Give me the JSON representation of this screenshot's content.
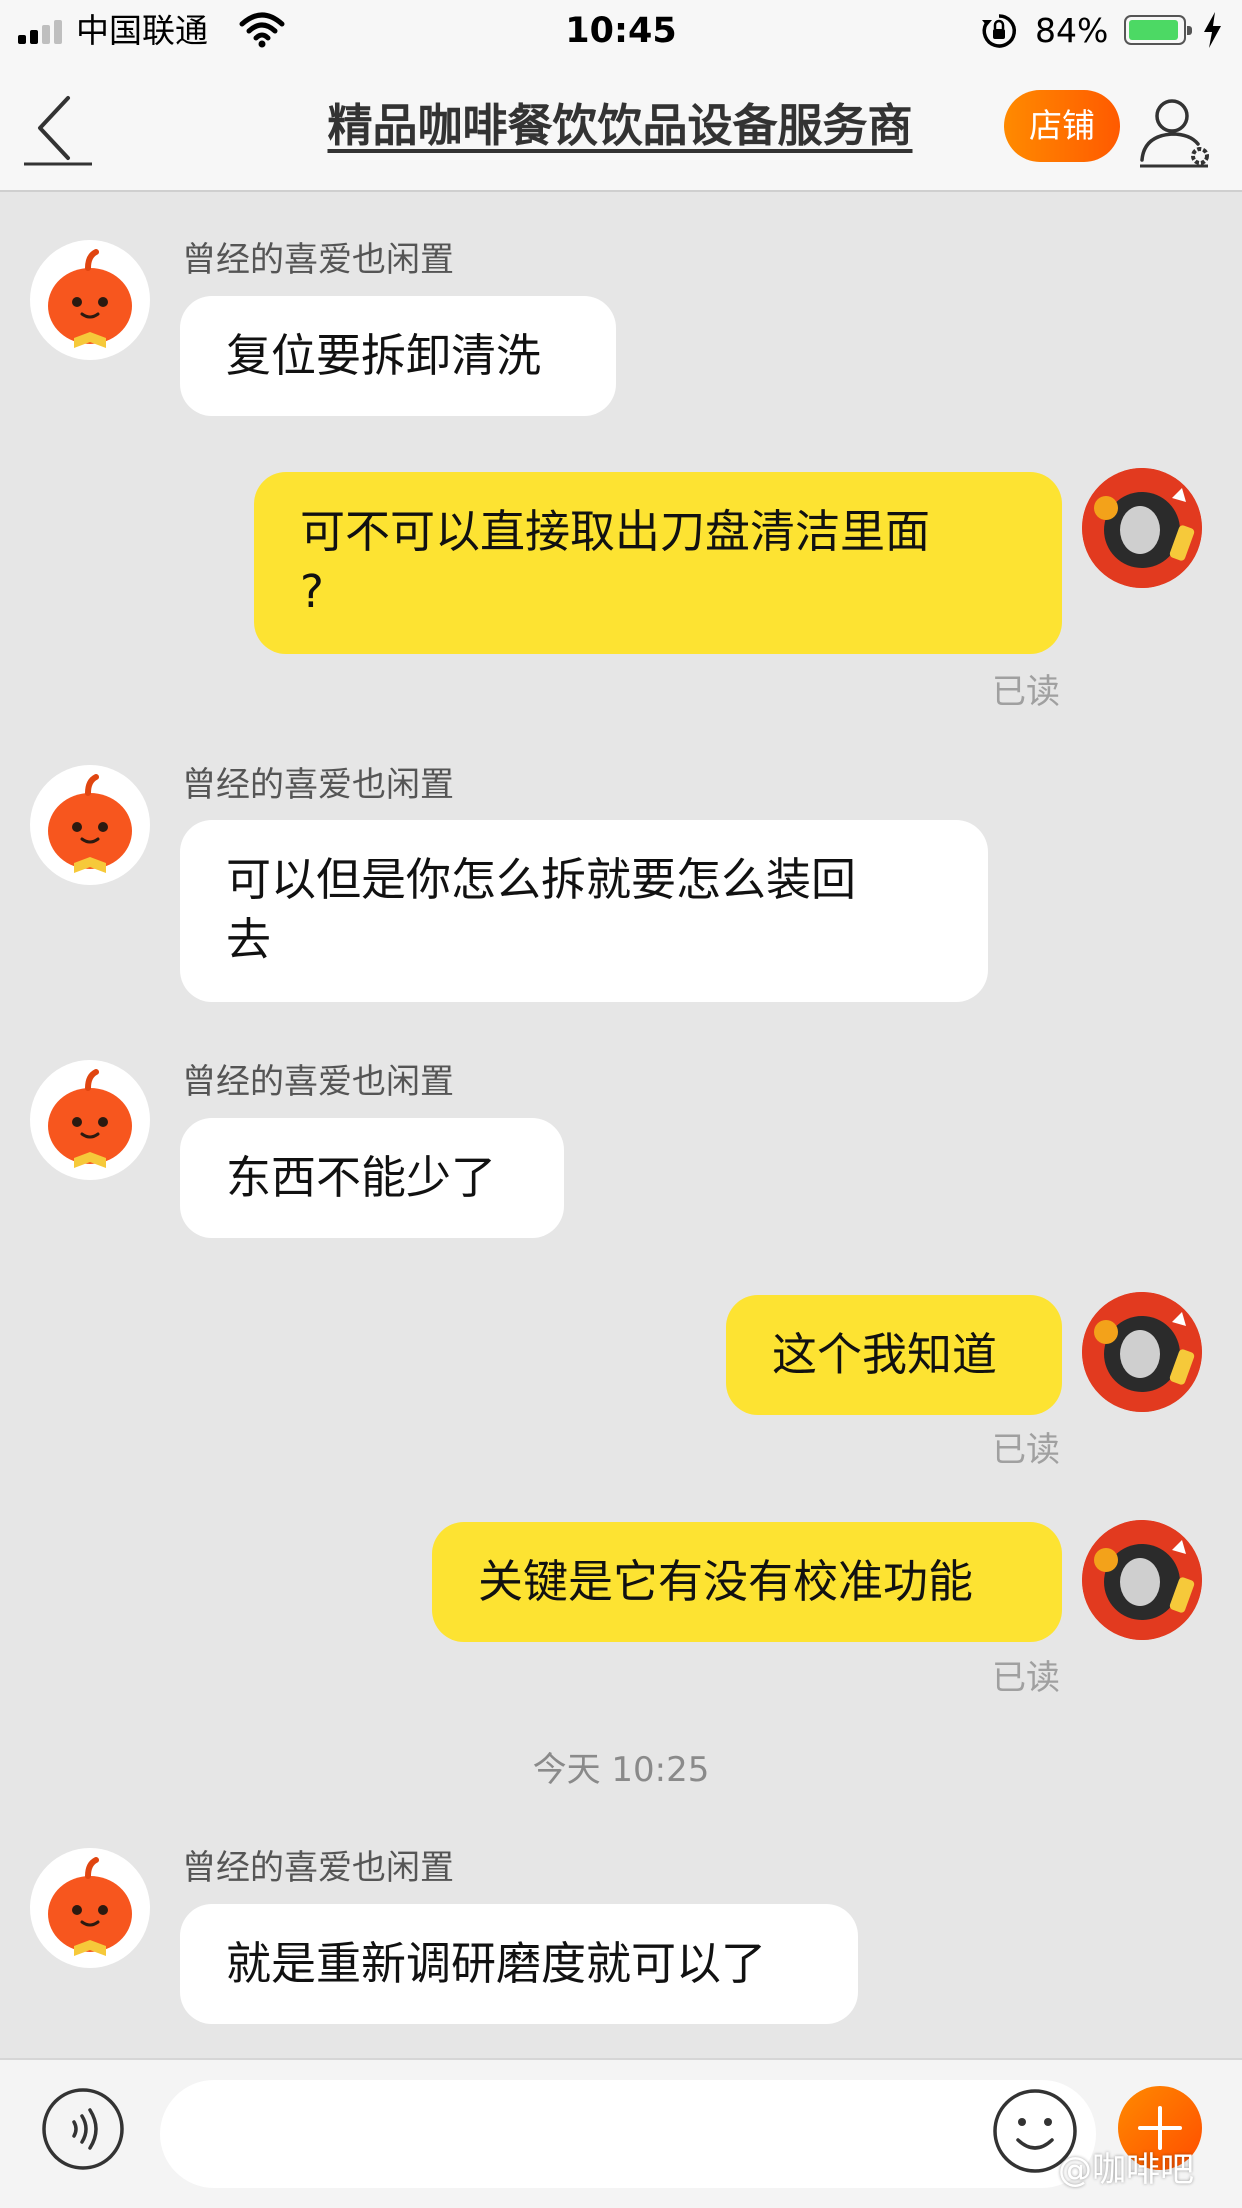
{
  "status_bar": {
    "carrier": "中国联通",
    "time": "10:45",
    "battery_percent_label": "84%",
    "battery_level": 0.84,
    "icons": [
      "signal-icon",
      "wifi-icon",
      "rotation-lock-icon",
      "battery-icon",
      "charging-bolt-icon"
    ]
  },
  "nav": {
    "back_icon": "chevron-left-icon",
    "title": "精品咖啡餐饮饮品设备服务商",
    "shop_label": "店铺",
    "user_settings_icon": "user-settings-icon"
  },
  "messages": [
    {
      "from": "other",
      "sender": "曾经的喜爱也闲置",
      "lines": [
        "复位要拆卸清洗"
      ]
    },
    {
      "from": "me",
      "lines": [
        "可不可以直接取出刀盘清洁里面",
        "?"
      ],
      "status": "已读"
    },
    {
      "from": "other",
      "sender": "曾经的喜爱也闲置",
      "lines": [
        "可以但是你怎么拆就要怎么装回",
        "去"
      ]
    },
    {
      "from": "other",
      "sender": "曾经的喜爱也闲置",
      "lines": [
        "东西不能少了"
      ]
    },
    {
      "from": "me",
      "lines": [
        "这个我知道"
      ],
      "status": "已读"
    },
    {
      "from": "me",
      "lines": [
        "关键是它有没有校准功能"
      ],
      "status": "已读"
    },
    {
      "type": "timestamp",
      "text": "今天 10:25"
    },
    {
      "from": "other",
      "sender": "曾经的喜爱也闲置",
      "lines": [
        "就是重新调研磨度就可以了"
      ]
    }
  ],
  "input_bar": {
    "voice_icon": "voice-icon",
    "placeholder": "",
    "emoji_icon": "emoji-icon",
    "plus_icon": "plus-icon"
  },
  "watermark": "@咖啡吧",
  "colors": {
    "background": "#e6e6e6",
    "my_bubble": "#fde332",
    "their_bubble": "#ffffff",
    "accent_orange": "#ff6a00"
  }
}
